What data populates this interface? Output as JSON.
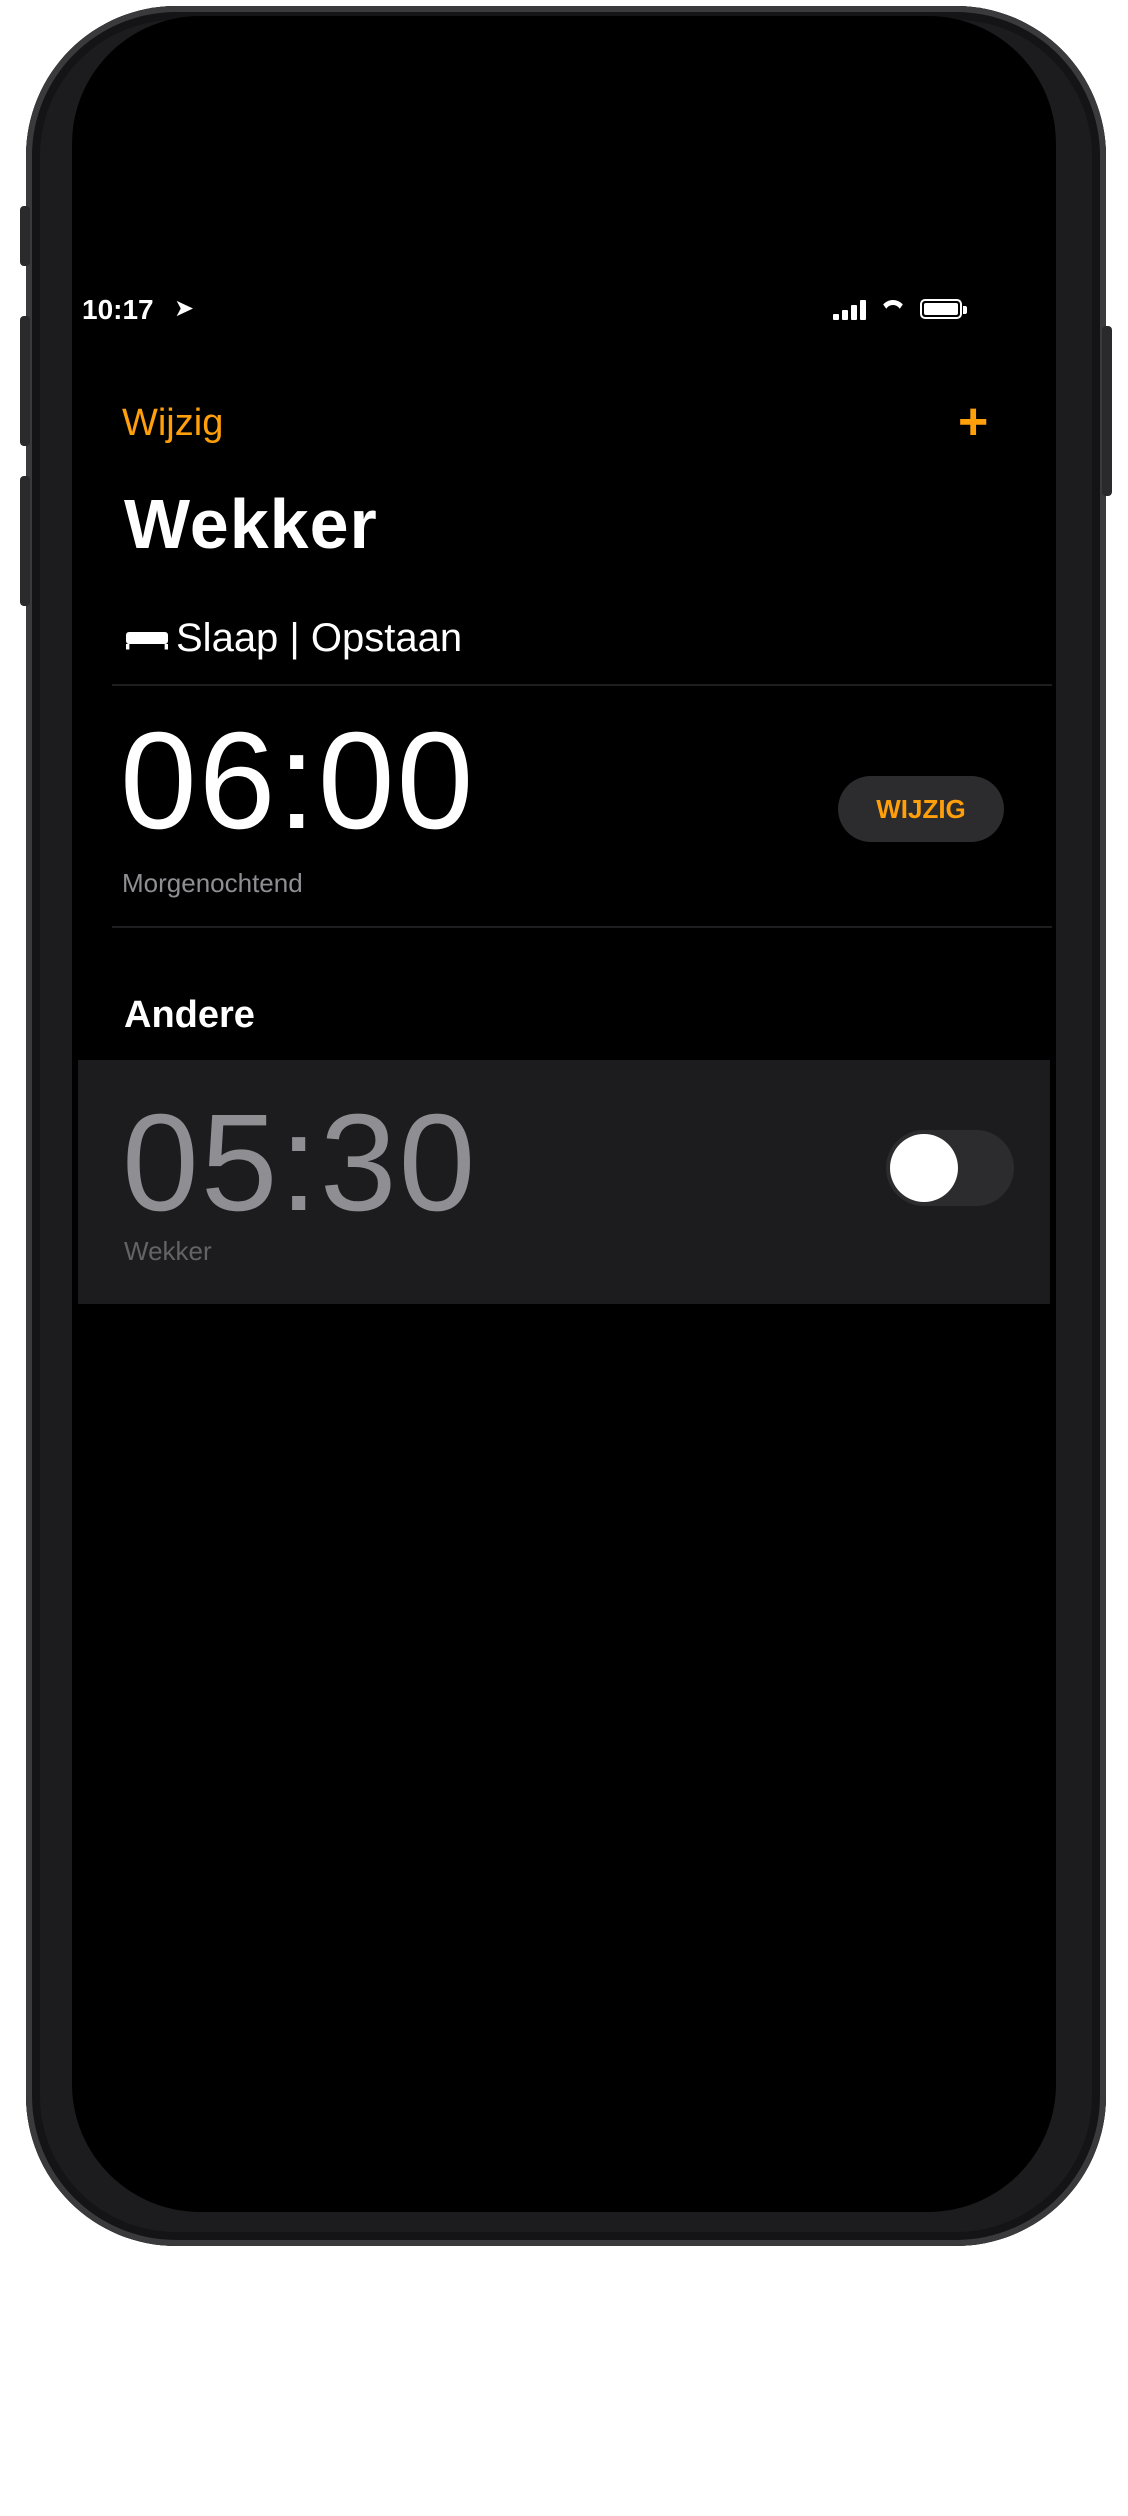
{
  "status_bar": {
    "time": "10:17",
    "location_icon": "location-arrow-icon",
    "signal_icon": "cellular-signal-icon",
    "wifi_icon": "wifi-icon",
    "battery_icon": "battery-icon"
  },
  "nav": {
    "edit_label": "Wijzig",
    "add_label": "+"
  },
  "title": "Wekker",
  "sleep_section": {
    "header": "Slaap | Opstaan",
    "alarm_time": "06:00",
    "subtitle": "Morgenochtend",
    "change_label": "WIJZIG"
  },
  "other_section": {
    "header": "Andere",
    "alarms": [
      {
        "time": "05:30",
        "label": "Wekker",
        "enabled": false
      }
    ]
  },
  "colors": {
    "accent": "#ff9f0a",
    "background": "#000000",
    "row_background": "#1c1c1e"
  }
}
